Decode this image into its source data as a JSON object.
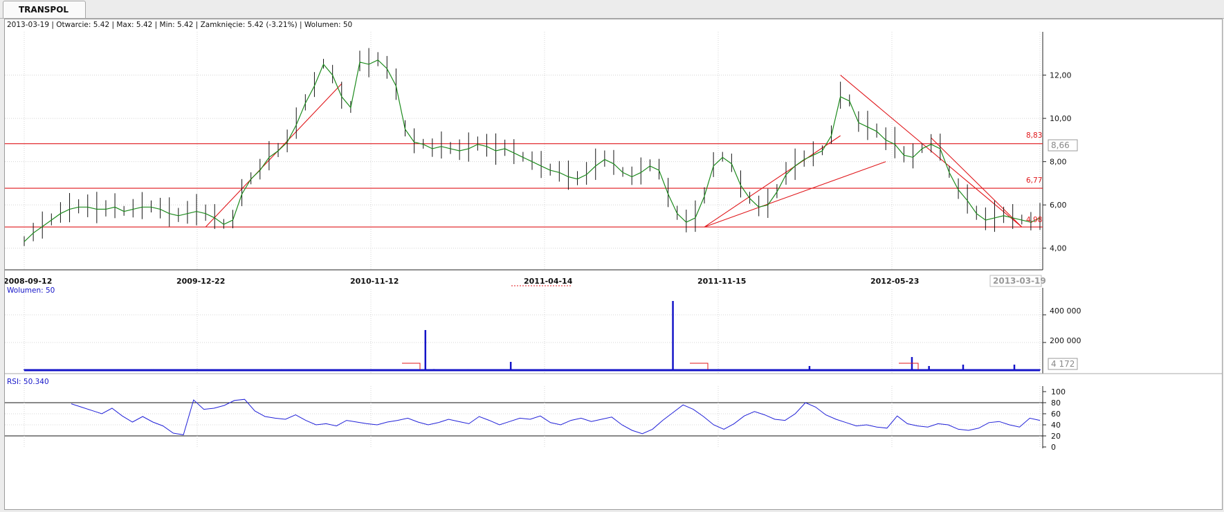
{
  "tab": {
    "label": "TRANSPOL"
  },
  "info_bar": {
    "text": "2013-03-19 | Otwarcie: 5.42 | Max: 5.42 | Min: 5.42 | Zamknięcie: 5.42 (-3.21%) | Wolumen: 50"
  },
  "price_axis": {
    "ticks": [
      "4,00",
      "6,00",
      "8,00",
      "10,00",
      "12,00"
    ],
    "current_label": "8,66"
  },
  "hlines": {
    "top": "8,83",
    "mid": "6,77",
    "low": "4,98"
  },
  "date_axis": {
    "labels": [
      "2008-09-12",
      "2009-12-22",
      "2010-11-12",
      "2011-04-14",
      "2011-11-15",
      "2012-05-23"
    ],
    "current_label": "2013-03-19"
  },
  "volume_panel": {
    "title": "Wolumen: 50",
    "ticks": [
      "200 000",
      "400 000"
    ],
    "current_label": "4 172"
  },
  "rsi_panel": {
    "title": "RSI: 50.340",
    "ticks": [
      "0",
      "20",
      "40",
      "60",
      "80",
      "100"
    ]
  },
  "chart_data": [
    {
      "type": "line",
      "name": "price",
      "x_range": [
        "2008-09-12",
        "2013-03-19"
      ],
      "ylim": [
        3.0,
        14.0
      ],
      "grid": true,
      "horizontal_levels": [
        8.83,
        6.77,
        4.98
      ],
      "values": [
        4.3,
        4.7,
        5.0,
        5.3,
        5.6,
        5.8,
        5.9,
        5.9,
        5.8,
        5.8,
        5.9,
        5.7,
        5.8,
        5.9,
        5.9,
        5.8,
        5.6,
        5.5,
        5.6,
        5.7,
        5.6,
        5.4,
        5.1,
        5.3,
        6.5,
        7.2,
        7.6,
        8.2,
        8.5,
        8.9,
        9.7,
        10.7,
        11.5,
        12.5,
        12.0,
        11.0,
        10.5,
        12.6,
        12.5,
        12.7,
        12.3,
        11.5,
        9.5,
        8.9,
        8.8,
        8.6,
        8.7,
        8.6,
        8.5,
        8.6,
        8.8,
        8.7,
        8.5,
        8.6,
        8.4,
        8.2,
        8.0,
        7.8,
        7.6,
        7.5,
        7.3,
        7.2,
        7.4,
        7.8,
        8.1,
        7.9,
        7.5,
        7.3,
        7.5,
        7.8,
        7.6,
        6.5,
        5.6,
        5.2,
        5.4,
        6.4,
        7.8,
        8.2,
        7.9,
        6.9,
        6.3,
        5.9,
        6.0,
        6.6,
        7.4,
        7.8,
        8.1,
        8.3,
        8.5,
        9.2,
        11.0,
        10.8,
        9.8,
        9.6,
        9.4,
        9.0,
        8.8,
        8.3,
        8.2,
        8.6,
        8.8,
        8.6,
        7.5,
        6.7,
        6.2,
        5.6,
        5.3,
        5.4,
        5.5,
        5.4,
        5.3,
        5.2,
        5.4
      ]
    },
    {
      "type": "bar",
      "name": "volume",
      "ylim": [
        0,
        500000
      ],
      "values": [
        5000,
        5000,
        4000,
        5000,
        6000,
        4000,
        5000,
        4000,
        5000,
        4000,
        5000,
        4000,
        5000,
        4000,
        5000,
        6000,
        4000,
        5000,
        4000,
        5000,
        4000,
        5000,
        4000,
        5000,
        7000,
        5000,
        4000,
        5000,
        4000,
        5000,
        6000,
        4000,
        5000,
        4000,
        5000,
        4000,
        5000,
        4000,
        5000,
        4000,
        5000,
        4000,
        5000,
        4000,
        5000,
        4000,
        5000,
        290000,
        8000,
        5000,
        4000,
        5000,
        7000,
        5000,
        4000,
        5000,
        6000,
        60000,
        5000,
        4000,
        5000,
        4000,
        5000,
        4000,
        5000,
        4000,
        5000,
        4000,
        5000,
        4000,
        5000,
        4000,
        5000,
        5000,
        4000,
        5000,
        500000,
        5000,
        4000,
        5000,
        4000,
        5000,
        4000,
        5000,
        5000,
        4000,
        5000,
        4000,
        5000,
        4000,
        5000,
        5000,
        30000,
        4000,
        5000,
        4000,
        5000,
        4000,
        5000,
        4000,
        5000,
        4000,
        5000,
        5000,
        95000,
        5000,
        30000,
        5000,
        4000,
        5000,
        40000,
        5000,
        4000,
        5000,
        4000,
        5000,
        40000,
        5000,
        4000,
        5000
      ]
    },
    {
      "type": "line",
      "name": "RSI",
      "ylim": [
        0,
        100
      ],
      "levels": [
        20,
        80
      ],
      "values": [
        78,
        72,
        66,
        60,
        70,
        56,
        45,
        55,
        45,
        38,
        25,
        22,
        85,
        68,
        70,
        75,
        84,
        86,
        65,
        55,
        52,
        50,
        58,
        48,
        40,
        42,
        38,
        48,
        45,
        42,
        40,
        45,
        48,
        52,
        45,
        40,
        44,
        50,
        46,
        42,
        55,
        48,
        40,
        46,
        52,
        50,
        56,
        44,
        40,
        48,
        52,
        46,
        50,
        54,
        40,
        30,
        24,
        32,
        48,
        62,
        76,
        68,
        55,
        40,
        32,
        42,
        56,
        64,
        58,
        50,
        48,
        60,
        80,
        72,
        58,
        50,
        44,
        38,
        40,
        36,
        34,
        56,
        42,
        38,
        36,
        42,
        40,
        32,
        30,
        34,
        44,
        46,
        40,
        36,
        52,
        48
      ]
    }
  ]
}
